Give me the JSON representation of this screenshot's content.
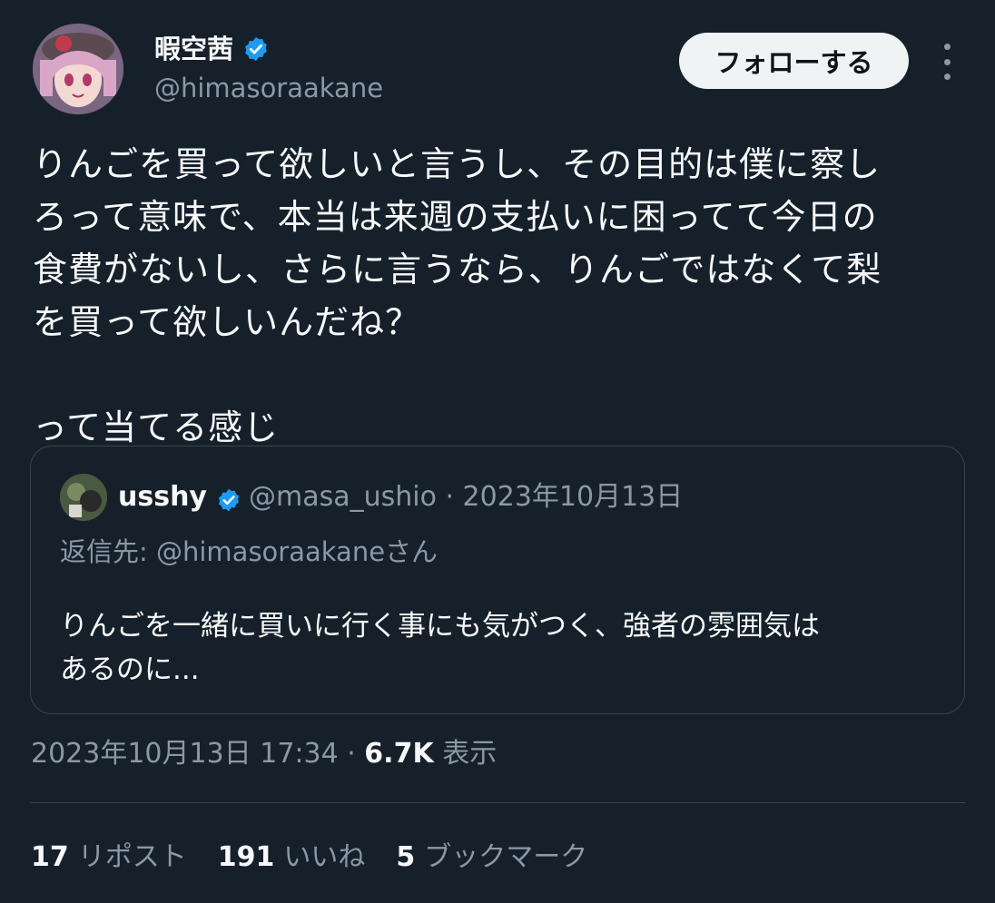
{
  "author": {
    "display_name": "暇空茜",
    "handle": "@himasoraakane",
    "avatar": "avatar-anime-girl"
  },
  "follow_label": "フォローする",
  "more_icon": "more-vertical-icon",
  "tweet": {
    "lines": [
      "りんごを買って欲しいと言うし、その目的は僕に察し",
      "ろって意味で、本当は来週の支払いに困ってて今日の",
      "食費がないし、さらに言うなら、りんごではなくて梨",
      "を買って欲しいんだね？",
      "",
      "って当てる感じ"
    ]
  },
  "quote": {
    "display_name": "usshy",
    "handle_date": "@masa_ushio · 2023年10月13日",
    "reply_to": "返信先: @himasoraakaneさん",
    "body_lines": [
      "りんごを一緒に買いに行く事にも気がつく、強者の雰囲気は",
      "あるのに..."
    ]
  },
  "meta": {
    "timestamp": "2023年10月13日 17:34 · ",
    "views": "6.7K",
    "views_label": " 表示"
  },
  "stats": {
    "reposts": "17",
    "reposts_label": "リポスト",
    "likes": "191",
    "likes_label": "いいね",
    "bookmarks": "5",
    "bookmarks_label": "ブックマーク"
  },
  "colors": {
    "background": "#15202b",
    "verified": "#1d9bf0",
    "secondary_text": "#8b98a5"
  }
}
